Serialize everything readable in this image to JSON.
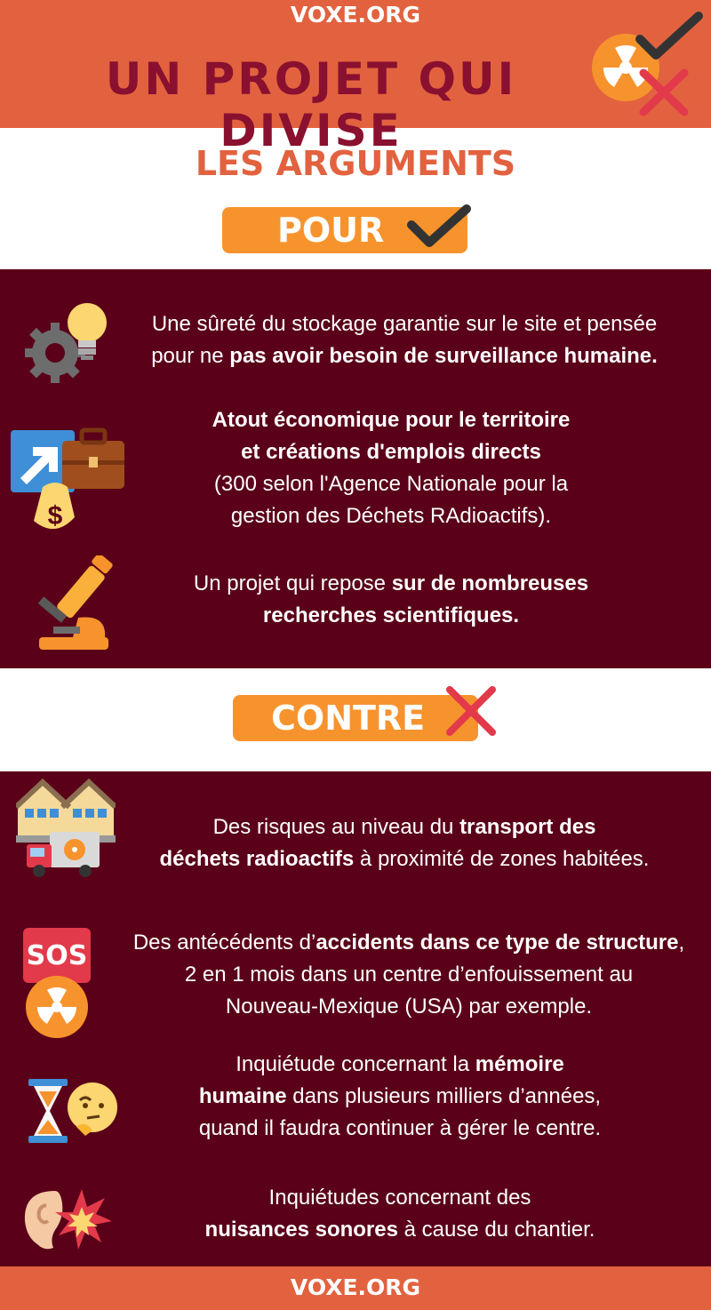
{
  "brand": "VOXE.ORG",
  "title": "UN PROJET QUI DIVISE",
  "arguments_title": "LES ARGUMENTS",
  "pour": {
    "label": "POUR",
    "items": [
      {
        "icon": "gear-bulb-icon",
        "pre": "Une sûreté du stockage garantie sur le site et pensée",
        "line2_pre": "pour ne ",
        "bold": "pas avoir besoin de surveillance humaine."
      },
      {
        "icon": "economy-icon",
        "bold1": "Atout économique pour le territoire",
        "bold2": "et créations d'emplois directs",
        "line3": "(300 selon l'Agence Nationale pour la",
        "line4": "gestion des Déchets RAdioactifs)."
      },
      {
        "icon": "microscope-icon",
        "pre": "Un projet qui repose ",
        "bold1": "sur de nombreuses",
        "bold2": "recherches scientifiques."
      }
    ]
  },
  "contre": {
    "label": "CONTRE",
    "items": [
      {
        "icon": "houses-truck-icon",
        "pre": "Des  risques au niveau du ",
        "bold1": "transport des",
        "bold2": "déchets radioactifs",
        "post": "  à proximité de zones habitées."
      },
      {
        "icon": "sos-radiation-icon",
        "sos": "SOS",
        "pre": "Des antécédents d’",
        "bold": "accidents dans ce type de structure",
        "post": ",",
        "line2": "2 en 1 mois dans un centre d’enfouissement au",
        "line3": "Nouveau-Mexique (USA) par exemple."
      },
      {
        "icon": "hourglass-thinking-icon",
        "pre": "Inquiétude concernant la ",
        "bold1": "mémoire",
        "bold2": "humaine",
        "post2": " dans plusieurs milliers d’années,",
        "line3": "quand il faudra continuer à gérer le centre."
      },
      {
        "icon": "ear-noise-icon",
        "line1": "Inquiétudes concernant des",
        "bold": "nuisances sonores",
        "post": " à cause du chantier."
      }
    ]
  },
  "colors": {
    "orange": "#e2623f",
    "pill": "#f7932d",
    "maroon": "#5a0018",
    "title_red": "#8a1030",
    "check": "#333333",
    "cross": "#e23a4a"
  }
}
